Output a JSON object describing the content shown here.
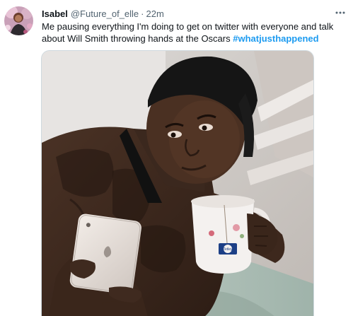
{
  "tweet": {
    "author": {
      "display_name": "Isabel",
      "handle": "@Future_of_elle",
      "separator": "·",
      "time": "22m"
    },
    "text_plain": "Me pausing everything I'm doing to get on twitter with everyone and talk about Will Smith throwing hands at the Oscars ",
    "hashtag": "#whatjusthappened",
    "more_icon": "more-horizontal-icon",
    "media": {
      "mug_brand": "Tetley"
    }
  }
}
